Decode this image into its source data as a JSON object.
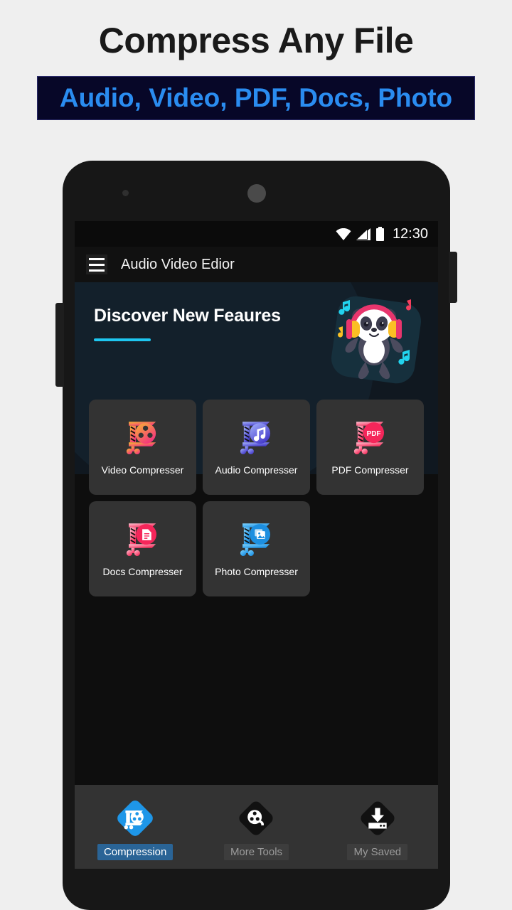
{
  "promo": {
    "title": "Compress Any File",
    "subtitle": "Audio, Video, PDF, Docs, Photo",
    "subtitle_color": "#2a8cf0",
    "subtitle_bg": "#070728"
  },
  "phone": {
    "statusbar": {
      "time": "12:30",
      "icons": [
        "wifi-icon",
        "signal-icon",
        "battery-icon"
      ]
    },
    "appbar": {
      "menu_icon": "hamburger-menu-icon",
      "title": "Audio Video Edior"
    },
    "banner": {
      "heading": "Discover New Feaures",
      "accent_color": "#1ec6f0",
      "background": "#101820",
      "illustration": "panda-headphones-icon"
    },
    "grid": {
      "items": [
        {
          "label": "Video Compresser",
          "icon": "video-compress-icon",
          "color_from": "#f7b733",
          "color_to": "#f4317f"
        },
        {
          "label": "Audio Compresser",
          "icon": "audio-compress-icon",
          "color_from": "#9aa7f0",
          "color_to": "#4a54d8"
        },
        {
          "label": "PDF Compresser",
          "icon": "pdf-compress-icon",
          "color_from": "#ffb3c6",
          "color_to": "#f72c5b"
        },
        {
          "label": "Docs Compresser",
          "icon": "docs-compress-icon",
          "color_from": "#ffb3c6",
          "color_to": "#f72c5b"
        },
        {
          "label": "Photo Compresser",
          "icon": "photo-compress-icon",
          "color_from": "#7fd4ff",
          "color_to": "#1a8fe3"
        }
      ]
    },
    "bottomnav": {
      "items": [
        {
          "label": "Compression",
          "icon": "compression-icon",
          "active": true
        },
        {
          "label": "More Tools",
          "icon": "more-tools-icon",
          "active": false
        },
        {
          "label": "My Saved",
          "icon": "my-saved-icon",
          "active": false
        }
      ],
      "active_color": "#2a6496",
      "idle_color": "#9b9b9b"
    }
  }
}
